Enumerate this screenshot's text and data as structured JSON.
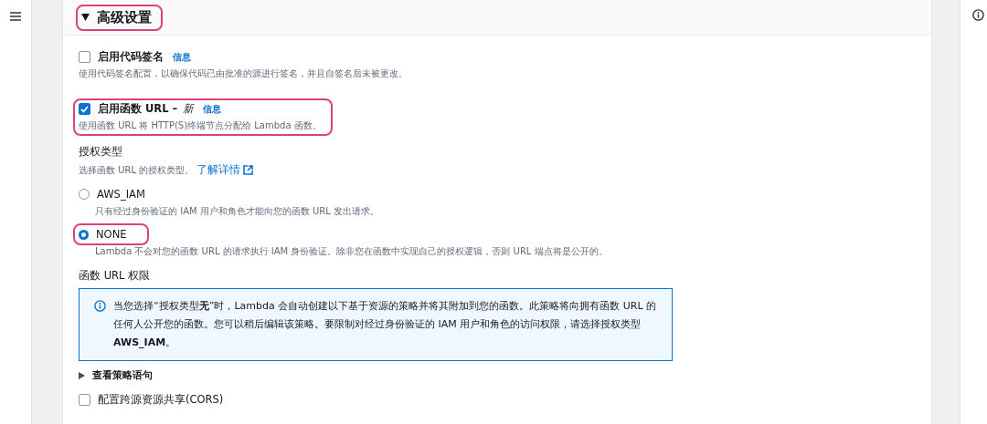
{
  "section": {
    "title": "高级设置",
    "expanded": true,
    "highlighted": true
  },
  "code_signing": {
    "label": "启用代码签名",
    "info": "信息",
    "checked": false,
    "highlighted": false,
    "description": "使用代码签名配置，以确保代码已由批准的源进行签名，并且自签名后未被更改。"
  },
  "function_url": {
    "label": "启用函数 URL –",
    "badge": "新",
    "info": "信息",
    "checked": true,
    "highlighted": true,
    "description": "使用函数 URL 将 HTTP(S)终端节点分配给 Lambda 函数。"
  },
  "auth_type": {
    "label": "授权类型",
    "description": "选择函数 URL 的授权类型。",
    "link": "了解详情",
    "options": [
      {
        "label": "AWS_IAM",
        "selected": false,
        "highlighted": false,
        "description": "只有经过身份验证的 IAM 用户和角色才能向您的函数 URL 发出请求。"
      },
      {
        "label": "NONE",
        "selected": true,
        "highlighted": true,
        "description": "Lambda 不会对您的函数 URL 的请求执行 IAM 身份验证。除非您在函数中实现自己的授权逻辑，否则 URL 端点将是公开的。"
      }
    ]
  },
  "permissions": {
    "label": "函数 URL 权限",
    "alert": "当您选择“授权类型**无**”时，Lambda 会自动创建以下基于资源的策略并将其附加到您的函数。此策略将向拥有函数 URL 的任何人公开您的函数。您可以稍后编辑该策略。要限制对经过身份验证的 IAM 用户和角色的访问权限，请选择授权类型 **AWS_IAM**。"
  },
  "policy_toggle": {
    "label": "查看策略语句",
    "expanded": false
  },
  "cors": {
    "label": "配置跨源资源共享(CORS)",
    "checked": false
  }
}
